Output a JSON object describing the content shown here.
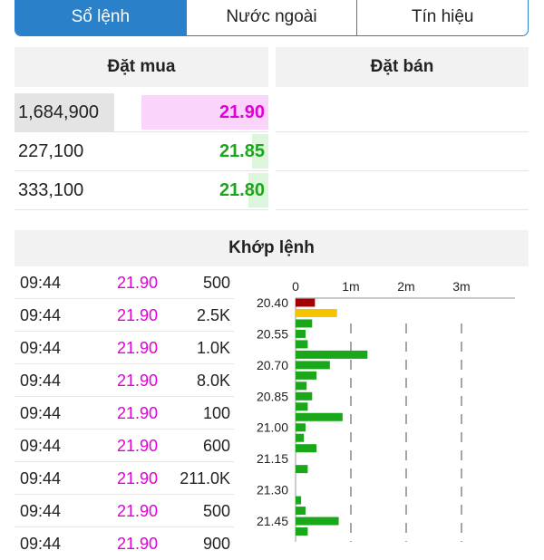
{
  "tabs": [
    {
      "label": "Sổ lệnh",
      "active": true
    },
    {
      "label": "Nước ngoài",
      "active": false
    },
    {
      "label": "Tín hiệu",
      "active": false
    }
  ],
  "order_book": {
    "buy_title": "Đặt mua",
    "sell_title": "Đặt bán",
    "buy_rows": [
      {
        "volume": "1,684,900",
        "price": "21.90",
        "price_color": "#e000d8",
        "highlight": true
      },
      {
        "volume": "227,100",
        "price": "21.85",
        "price_color": "#1aa81a",
        "highlight": false
      },
      {
        "volume": "333,100",
        "price": "21.80",
        "price_color": "#1aa81a",
        "highlight": false
      }
    ]
  },
  "matched": {
    "title": "Khớp lệnh",
    "trades": [
      {
        "time": "09:44",
        "price": "21.90",
        "volume": "500"
      },
      {
        "time": "09:44",
        "price": "21.90",
        "volume": "2.5K"
      },
      {
        "time": "09:44",
        "price": "21.90",
        "volume": "1.0K"
      },
      {
        "time": "09:44",
        "price": "21.90",
        "volume": "8.0K"
      },
      {
        "time": "09:44",
        "price": "21.90",
        "volume": "100"
      },
      {
        "time": "09:44",
        "price": "21.90",
        "volume": "600"
      },
      {
        "time": "09:44",
        "price": "21.90",
        "volume": "211.0K"
      },
      {
        "time": "09:44",
        "price": "21.90",
        "volume": "500"
      },
      {
        "time": "09:44",
        "price": "21.90",
        "volume": "900"
      }
    ]
  },
  "colors": {
    "accent": "#2a80c9",
    "ceiling": "#e000d8",
    "up": "#1aa81a",
    "down": "#a00000",
    "reference": "#f5c400"
  },
  "chart_data": {
    "type": "bar",
    "orientation": "horizontal",
    "x_ticks": [
      "0",
      "1m",
      "2m",
      "3m"
    ],
    "xlim": [
      0,
      3.7
    ],
    "y_ticks": [
      "20.40",
      "20.55",
      "20.70",
      "20.85",
      "21.00",
      "21.15",
      "21.30",
      "21.45"
    ],
    "ylim": [
      20.4,
      21.55
    ],
    "bars": [
      {
        "price": 20.4,
        "value": 0.35,
        "color": "#a00000"
      },
      {
        "price": 20.45,
        "value": 0.75,
        "color": "#f5c400"
      },
      {
        "price": 20.5,
        "value": 0.3,
        "color": "#1aa81a"
      },
      {
        "price": 20.55,
        "value": 0.18,
        "color": "#1aa81a"
      },
      {
        "price": 20.6,
        "value": 0.22,
        "color": "#1aa81a"
      },
      {
        "price": 20.65,
        "value": 1.3,
        "color": "#1aa81a"
      },
      {
        "price": 20.7,
        "value": 0.62,
        "color": "#1aa81a"
      },
      {
        "price": 20.75,
        "value": 0.38,
        "color": "#1aa81a"
      },
      {
        "price": 20.8,
        "value": 0.2,
        "color": "#1aa81a"
      },
      {
        "price": 20.85,
        "value": 0.3,
        "color": "#1aa81a"
      },
      {
        "price": 20.9,
        "value": 0.22,
        "color": "#1aa81a"
      },
      {
        "price": 20.95,
        "value": 0.85,
        "color": "#1aa81a"
      },
      {
        "price": 21.0,
        "value": 0.18,
        "color": "#1aa81a"
      },
      {
        "price": 21.05,
        "value": 0.15,
        "color": "#1aa81a"
      },
      {
        "price": 21.1,
        "value": 0.38,
        "color": "#1aa81a"
      },
      {
        "price": 21.2,
        "value": 0.22,
        "color": "#1aa81a"
      },
      {
        "price": 21.35,
        "value": 0.1,
        "color": "#1aa81a"
      },
      {
        "price": 21.4,
        "value": 0.18,
        "color": "#1aa81a"
      },
      {
        "price": 21.45,
        "value": 0.78,
        "color": "#1aa81a"
      },
      {
        "price": 21.5,
        "value": 0.22,
        "color": "#1aa81a"
      }
    ]
  }
}
